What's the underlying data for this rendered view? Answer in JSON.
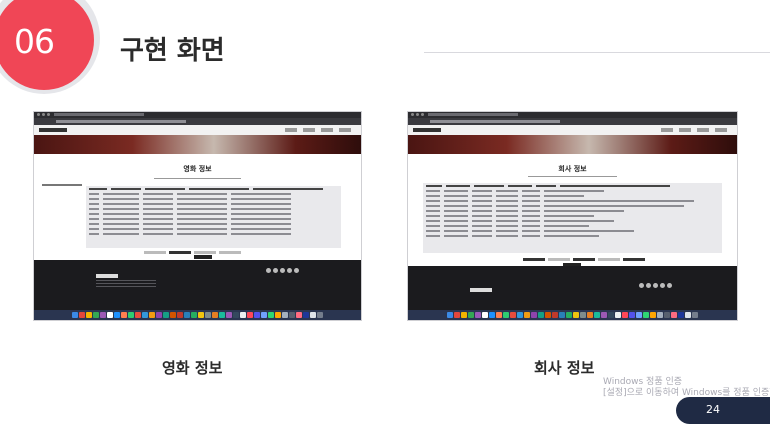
{
  "section": {
    "number": "06",
    "title": "구현 화면"
  },
  "screenshots": [
    {
      "caption": "영화 정보",
      "page_title": "영화 정보"
    },
    {
      "caption": "회사 정보",
      "page_title": "회사 정보"
    }
  ],
  "watermark": {
    "line1": "Windows 정품 인증",
    "line2": "[설정]으로 이동하여 Windows를 정품 인증합니다."
  },
  "page_number": "24",
  "colors": {
    "accent": "#f04656",
    "navy": "#1f2a44",
    "badge_ring": "#e5e6ea"
  }
}
